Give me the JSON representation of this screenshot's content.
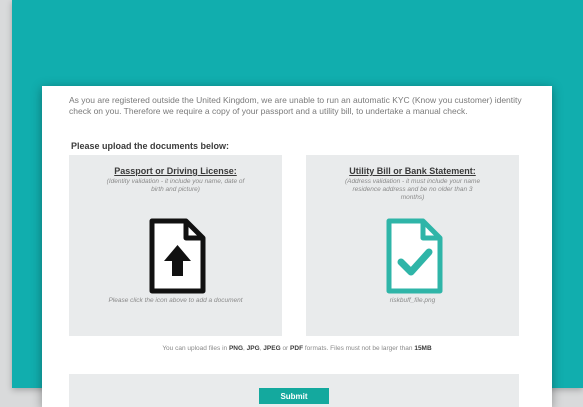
{
  "intro_text": "As you are registered outside the United Kingdom, we are unable to run an automatic KYC (Know you customer) identity check on you. Therefore we require a copy of your passport and a utility bill, to undertake a manual check.",
  "upload_heading": "Please upload the documents below:",
  "left_panel": {
    "title": "Passport or Driving License:",
    "description": "(Identity validation - it include you name, date of birth and picture)",
    "caption": "Please click the icon above to add a document",
    "icon": "upload-document-icon",
    "icon_color": "#111111"
  },
  "right_panel": {
    "title": "Utility Bill or Bank Statement:",
    "description": "(Address validation - it must include your name residence address and be no older than 3 months)",
    "caption": "riskbuff_file.png",
    "icon": "document-check-icon",
    "icon_color": "#2fb5a8"
  },
  "formats": {
    "prefix": "You can upload files in ",
    "png": "PNG",
    "sep1": ", ",
    "jpg": "JPG",
    "sep2": ", ",
    "jpeg": "JPEG",
    "or": " or ",
    "pdf": "PDF",
    "middle": " formats. Files must not be larger than ",
    "size": "15MB"
  },
  "submit_label": "Submit",
  "colors": {
    "teal_background": "#11aeae",
    "submit_button": "#14a99e"
  }
}
